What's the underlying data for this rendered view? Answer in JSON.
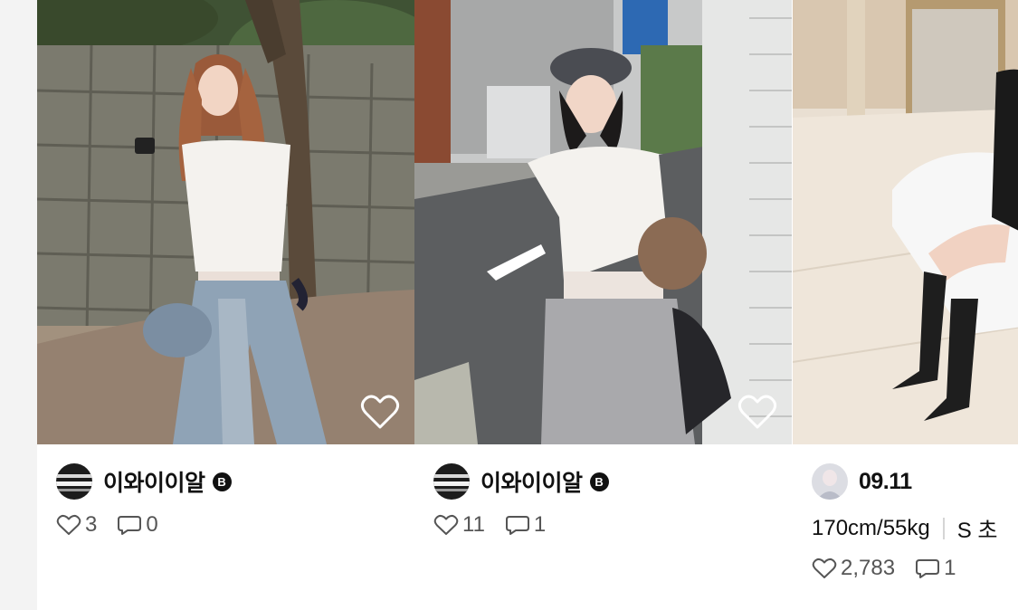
{
  "posts": [
    {
      "author": "이와이이알",
      "badge": "B",
      "likes": "3",
      "comments": "0",
      "liked": false
    },
    {
      "author": "이와이이알",
      "badge": "B",
      "likes": "11",
      "comments": "1",
      "liked": false
    },
    {
      "author": "09.11",
      "specs": [
        "170cm/55kg",
        "S 초"
      ],
      "likes": "2,783",
      "comments": "1"
    }
  ],
  "colors": {
    "text_primary": "#111111",
    "text_secondary": "#555555",
    "gutter": "#f3f3f3",
    "overlay_heart": "#ffffff"
  },
  "icons": [
    "heart-outline-icon",
    "comment-icon",
    "brand-badge-icon"
  ]
}
